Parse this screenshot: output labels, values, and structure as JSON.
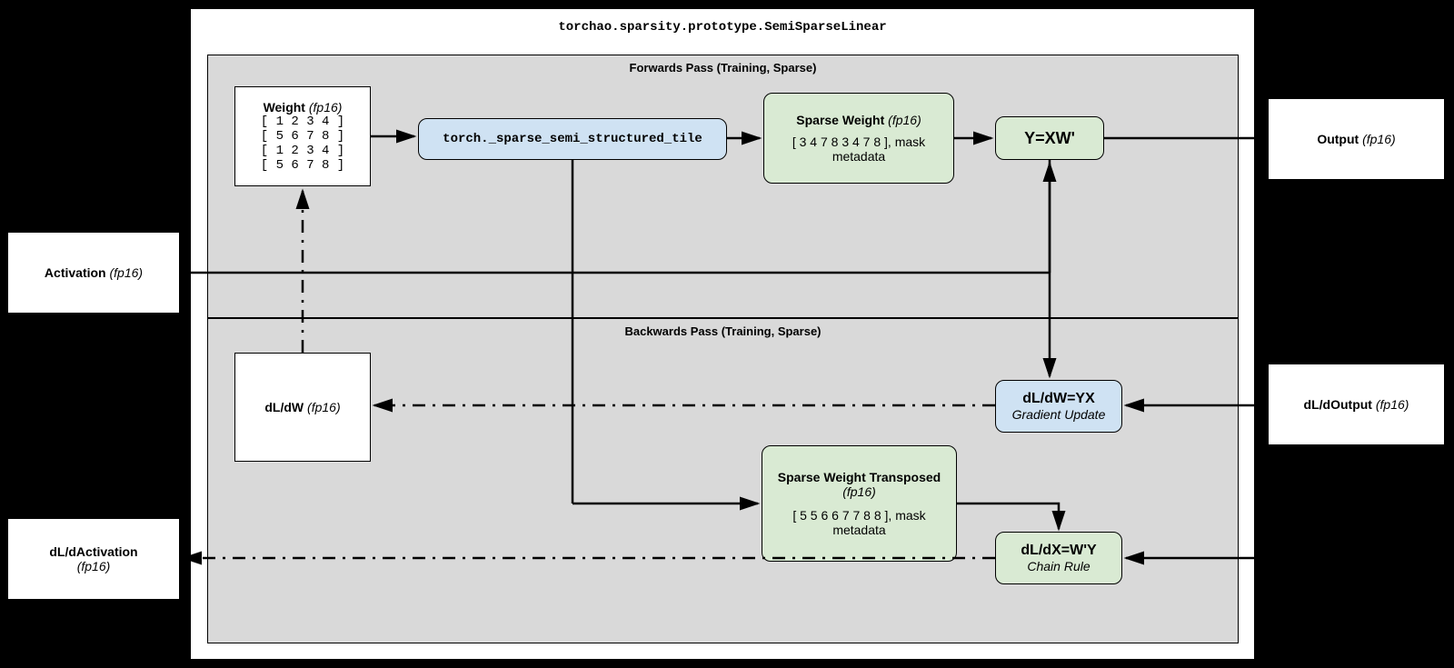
{
  "title": "torchao.sparsity.prototype.SemiSparseLinear",
  "sections": {
    "forward": "Forwards Pass (Training, Sparse)",
    "backward": "Backwards Pass (Training, Sparse)"
  },
  "io": {
    "activation_label": "Activation",
    "activation_type": "(fp16)",
    "output_label": "Output",
    "output_type": "(fp16)",
    "dLdActivation_label": "dL/dActivation",
    "dLdActivation_type": "(fp16)",
    "dLdOutput_label": "dL/dOutput",
    "dLdOutput_type": "(fp16)"
  },
  "weight": {
    "title": "Weight",
    "type": "(fp16)",
    "row1": "[ 1 2 3 4 ]",
    "row2": "[ 5 6 7 8 ]",
    "row3": "[ 1 2 3 4 ]",
    "row4": "[ 5 6 7 8 ]"
  },
  "op_tile": "torch._sparse_semi_structured_tile",
  "sparse_weight": {
    "title": "Sparse Weight",
    "type": "(fp16)",
    "data": "[ 3 4 7 8 3 4 7 8 ], mask metadata"
  },
  "op_yx": "Y=XW'",
  "dLdW_box": {
    "title": "dL/dW",
    "type": "(fp16)"
  },
  "op_dLdW": {
    "formula": "dL/dW=YX",
    "sub": "Gradient Update"
  },
  "sparse_weight_t": {
    "title": "Sparse Weight Transposed",
    "type": "(fp16)",
    "data": "[ 5 5 6 6 7 7 8 8 ], mask metadata"
  },
  "op_dLdX": {
    "formula": "dL/dX=W'Y",
    "sub": "Chain Rule"
  }
}
